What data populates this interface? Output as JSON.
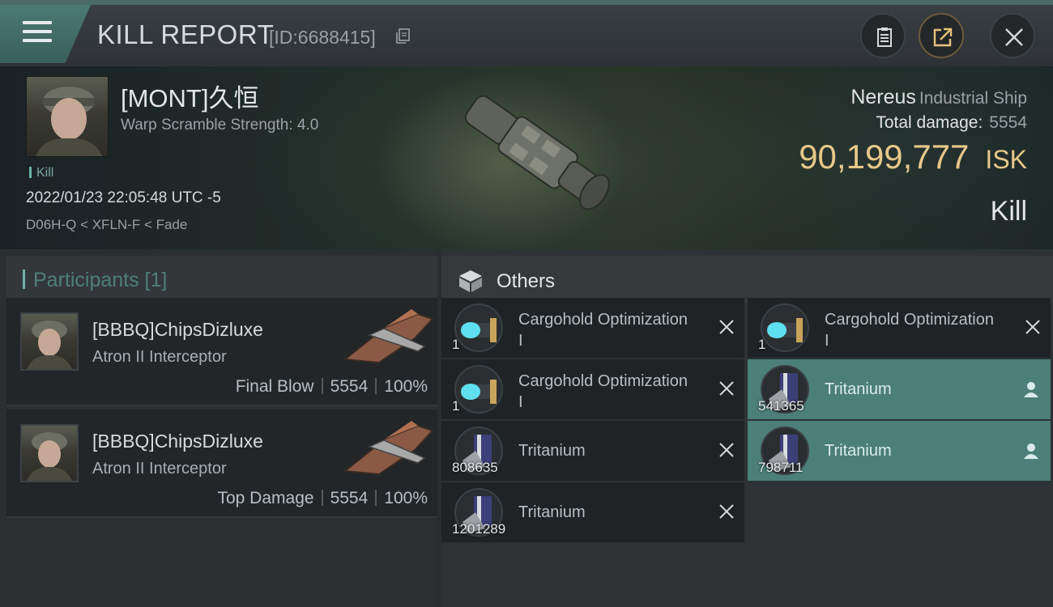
{
  "header": {
    "title": "KILL REPORT",
    "report_id": "[ID:6688415]",
    "buttons": [
      "clipboard-icon",
      "share-icon",
      "close-icon"
    ]
  },
  "victim": {
    "name": "[MONT]久恒",
    "warp_scramble": "Warp Scramble Strength: 4.0",
    "tag": "Kill",
    "datetime": "2022/01/23 22:05:48 UTC -5",
    "location": "D06H-Q < XFLN-F < Fade",
    "ship_name": "Nereus",
    "ship_class": "Industrial Ship",
    "total_damage_label": "Total damage:",
    "total_damage": "5554",
    "isk_value": "90,199,777",
    "isk_unit": "ISK",
    "result": "Kill"
  },
  "participants": {
    "title": "Participants [1]",
    "rows": [
      {
        "name": "[BBBQ]ChipsDizluxe",
        "ship": "Atron II Interceptor",
        "role": "Final Blow",
        "damage": "5554",
        "percent": "100%"
      },
      {
        "name": "[BBBQ]ChipsDizluxe",
        "ship": "Atron II Interceptor",
        "role": "Top Damage",
        "damage": "5554",
        "percent": "100%"
      }
    ]
  },
  "others": {
    "title": "Others",
    "left": [
      {
        "name": "Cargohold Optimization I",
        "qty": "1",
        "icon": "cargohold-rig-icon"
      },
      {
        "name": "Cargohold Optimization I",
        "qty": "1",
        "icon": "cargohold-rig-icon"
      },
      {
        "name": "Tritanium",
        "qty": "808635",
        "icon": "tritanium-icon"
      },
      {
        "name": "Tritanium",
        "qty": "1201289",
        "icon": "tritanium-icon"
      }
    ],
    "right": [
      {
        "name": "Cargohold Optimization I",
        "qty": "1",
        "icon": "cargohold-rig-icon",
        "dropped": false
      },
      {
        "name": "Tritanium",
        "qty": "541365",
        "icon": "tritanium-icon",
        "dropped": true
      },
      {
        "name": "Tritanium",
        "qty": "798711",
        "icon": "tritanium-icon",
        "dropped": true
      }
    ]
  },
  "colors": {
    "accent": "#4c7f77",
    "isk": "#e7c889"
  }
}
